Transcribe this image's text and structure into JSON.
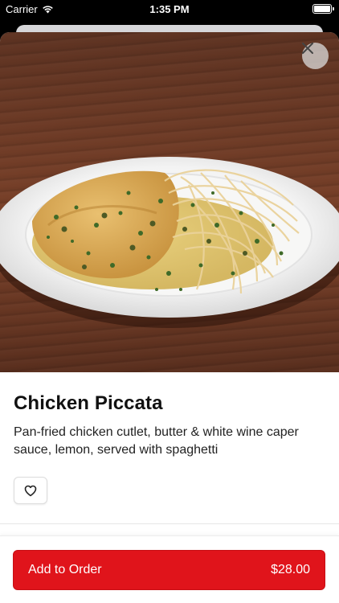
{
  "status_bar": {
    "carrier": "Carrier",
    "time": "1:35 PM"
  },
  "icons": {
    "wifi": "wifi-icon",
    "battery": "battery-icon",
    "close": "close-icon",
    "favorite": "heart-icon"
  },
  "item": {
    "name": "Chicken Piccata",
    "description": "Pan-fried chicken cutlet, butter & white wine caper sauce, lemon, served with spaghetti"
  },
  "order_button": {
    "label": "Add to Order",
    "price": "$28.00"
  },
  "colors": {
    "accent": "#e0141b"
  }
}
